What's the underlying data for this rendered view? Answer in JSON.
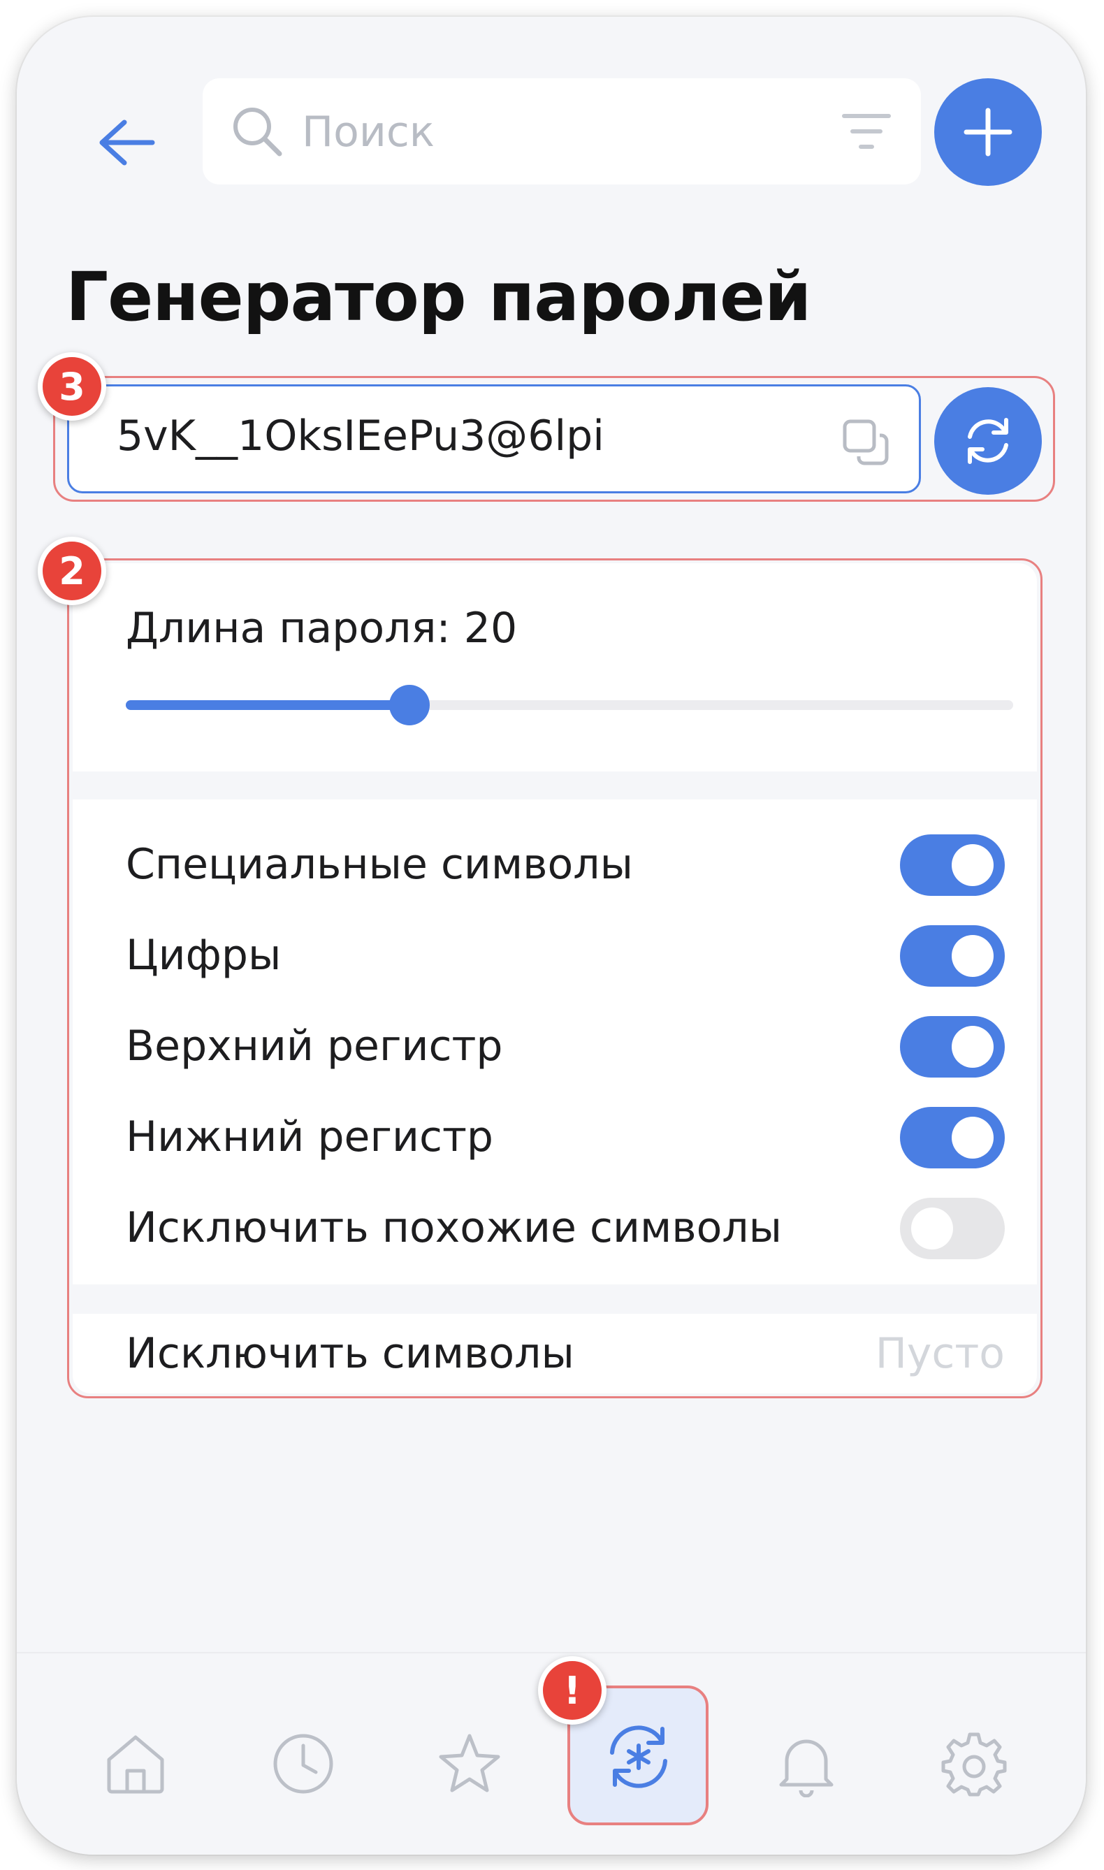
{
  "header": {
    "search_placeholder": "Поиск",
    "icons": {
      "back": "arrow-left-icon",
      "search": "search-icon",
      "filter": "filter-icon",
      "add": "plus-icon"
    }
  },
  "page": {
    "title": "Генератор паролей"
  },
  "password": {
    "value": "5vK__1OksIEePu3@6lpi",
    "copy_icon": "copy-icon",
    "refresh_icon": "refresh-icon"
  },
  "length": {
    "label": "Длина пароля: 20",
    "value": 20,
    "slider_fraction": 0.32
  },
  "toggles": [
    {
      "label": "Специальные символы",
      "on": true
    },
    {
      "label": "Цифры",
      "on": true
    },
    {
      "label": "Верхний регистр",
      "on": true
    },
    {
      "label": "Нижний регистр",
      "on": true
    },
    {
      "label": "Исключить похожие символы",
      "on": false
    }
  ],
  "exclude": {
    "label": "Исключить символы",
    "value": "Пусто"
  },
  "badges": {
    "password_row": "3",
    "settings": "2",
    "nav": "!"
  },
  "bottom_nav": {
    "items": [
      {
        "icon": "home-icon",
        "active": false
      },
      {
        "icon": "clock-icon",
        "active": false
      },
      {
        "icon": "star-icon",
        "active": false
      },
      {
        "icon": "password-generator-icon",
        "active": true
      },
      {
        "icon": "bell-icon",
        "active": false
      },
      {
        "icon": "gear-icon",
        "active": false
      }
    ]
  },
  "colors": {
    "accent": "#4a7ee3",
    "background": "#f5f6f9",
    "highlight": "#e88080",
    "badge": "#e8433a"
  }
}
